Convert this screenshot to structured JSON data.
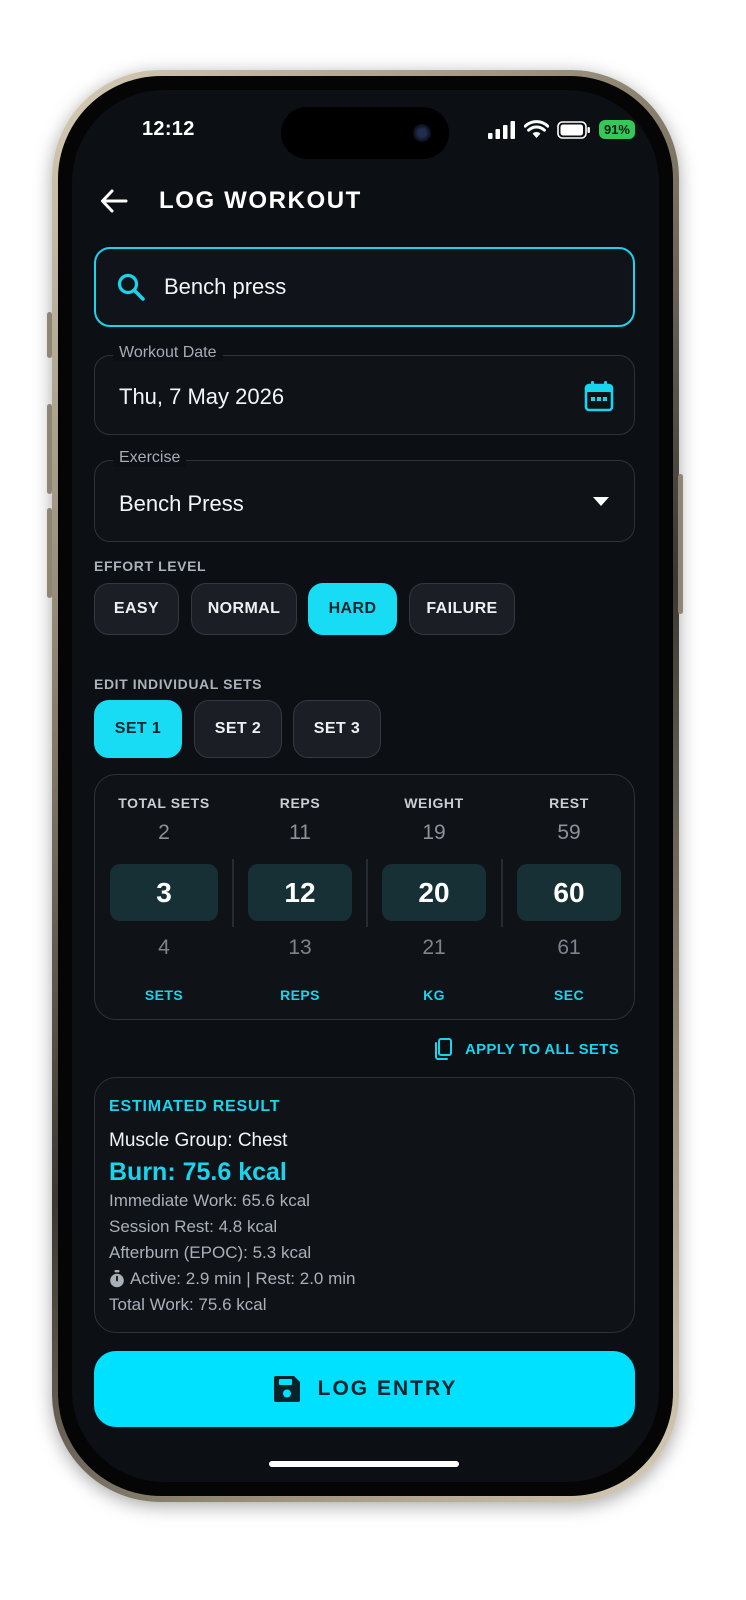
{
  "status_bar": {
    "time": "12:12",
    "battery_percent": "91%",
    "icons": [
      "cellular-signal-icon",
      "wifi-icon",
      "battery-icon"
    ]
  },
  "header": {
    "title": "LOG WORKOUT",
    "back_icon": "arrow-left-icon"
  },
  "search": {
    "value": "Bench press",
    "icon": "search-icon"
  },
  "workout_date": {
    "label": "Workout Date",
    "value": "Thu, 7 May 2026",
    "icon": "calendar-icon"
  },
  "exercise": {
    "label": "Exercise",
    "value": "Bench Press",
    "icon": "dropdown-triangle-icon"
  },
  "effort": {
    "label": "EFFORT LEVEL",
    "options": [
      "EASY",
      "NORMAL",
      "HARD",
      "FAILURE"
    ],
    "selected": "HARD"
  },
  "sets_editor": {
    "label": "EDIT INDIVIDUAL SETS",
    "tabs": [
      "SET 1",
      "SET 2",
      "SET 3"
    ],
    "selected": "SET 1"
  },
  "picker": {
    "columns": [
      {
        "header": "TOTAL SETS",
        "prev": "2",
        "selected": "3",
        "next": "4",
        "unit": "SETS"
      },
      {
        "header": "REPS",
        "prev": "11",
        "selected": "12",
        "next": "13",
        "unit": "REPS"
      },
      {
        "header": "WEIGHT",
        "prev": "19",
        "selected": "20",
        "next": "21",
        "unit": "KG"
      },
      {
        "header": "REST",
        "prev": "59",
        "selected": "60",
        "next": "61",
        "unit": "SEC"
      }
    ]
  },
  "apply_all": {
    "label": "APPLY TO ALL SETS",
    "icon": "copy-icon"
  },
  "result": {
    "title": "ESTIMATED RESULT",
    "muscle": "Muscle Group: Chest",
    "burn": "Burn: 75.6 kcal",
    "lines": [
      "Immediate Work: 65.6 kcal",
      "Session Rest: 4.8 kcal",
      "Afterburn (EPOC): 5.3 kcal",
      "Active: 2.9 min | Rest: 2.0 min",
      "Total Work: 75.6 kcal"
    ],
    "timer_icon": "stopwatch-icon"
  },
  "log_button": {
    "label": "LOG ENTRY",
    "icon": "save-icon"
  },
  "colors": {
    "accent": "#18d4ec",
    "background": "#0c0f14",
    "selected_cell": "#163035"
  }
}
